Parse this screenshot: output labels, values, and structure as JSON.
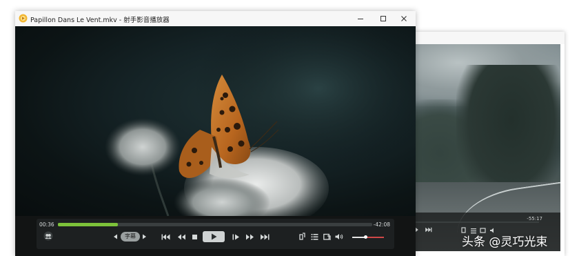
{
  "background_window": {
    "time_remaining": "-55:17"
  },
  "main_window": {
    "title": "Papillon Dans Le Vent.mkv - 射手影音播放器",
    "controls": {
      "time_elapsed": "00:36",
      "time_remaining": "-42:08",
      "progress_fraction": 0.19,
      "subtitle_label": "字幕",
      "volume_fraction": 0.42
    }
  },
  "watermark": {
    "text": "头条 @灵巧光束"
  },
  "colors": {
    "progress": "#7dc23a",
    "control_bar": "#1d2021",
    "titlebar": "#f7f7f7"
  }
}
